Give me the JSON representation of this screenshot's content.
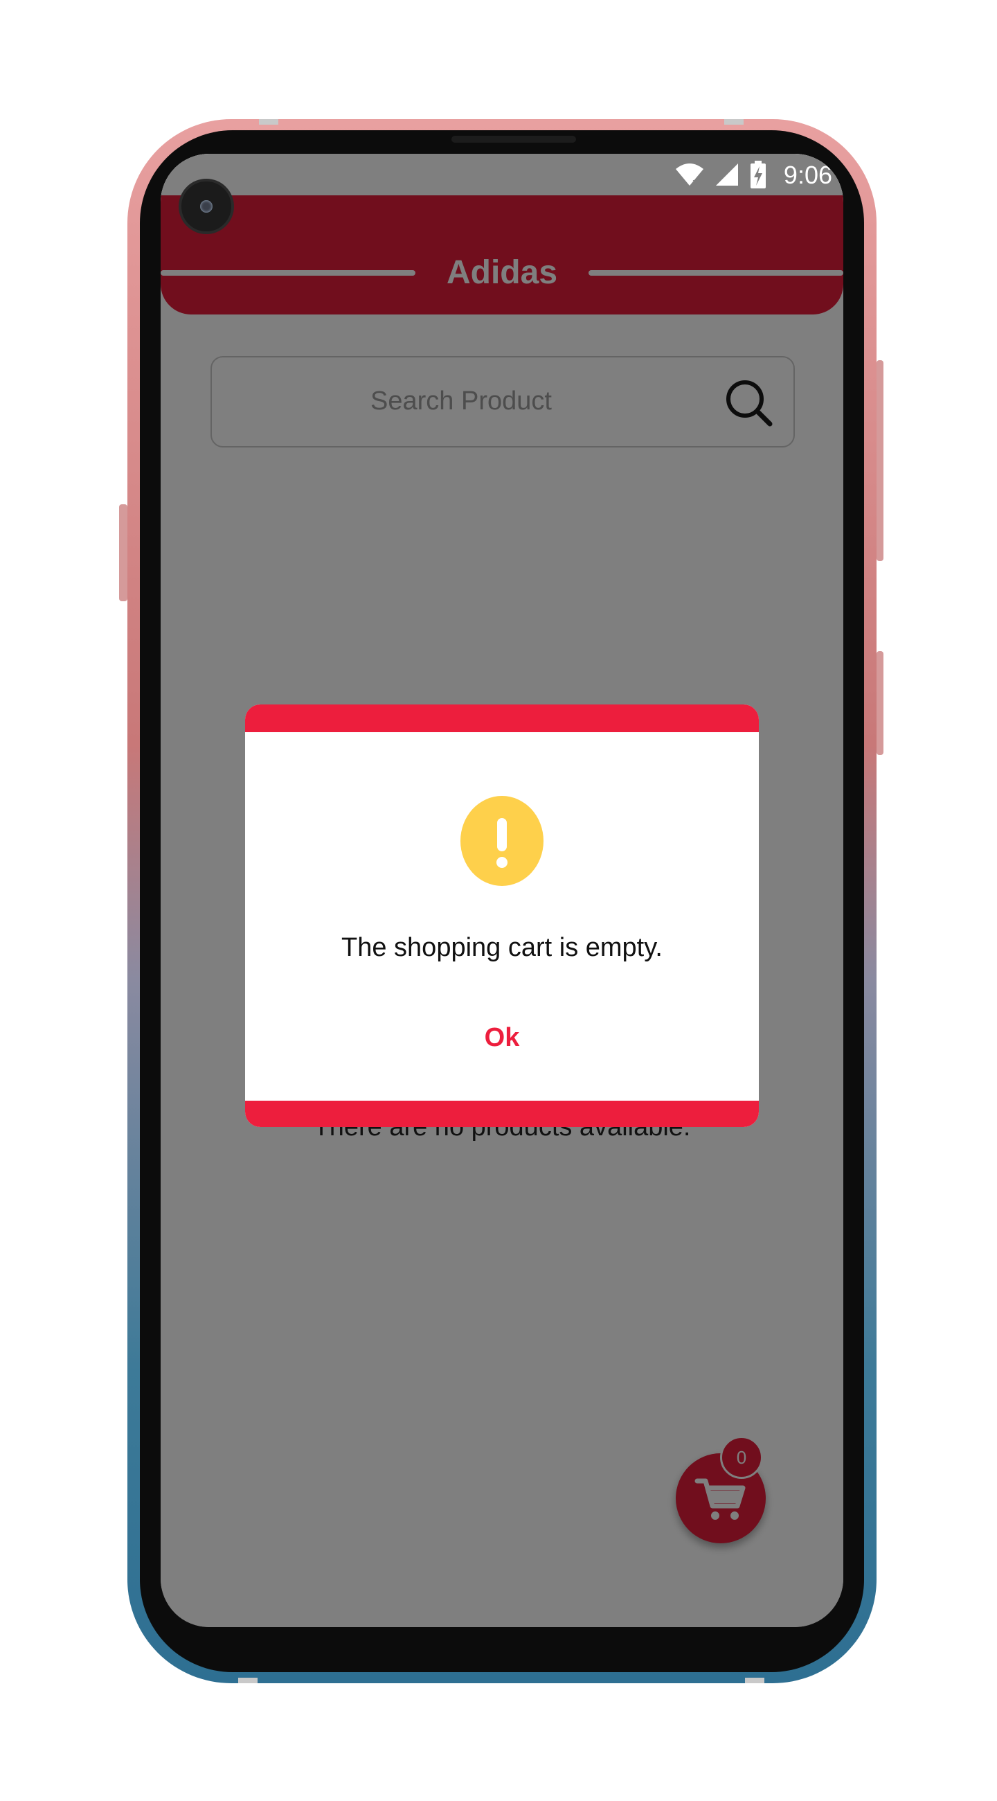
{
  "status_bar": {
    "time": "9:06",
    "icons": [
      "wifi-icon",
      "signal-icon",
      "battery-charging-icon"
    ]
  },
  "header": {
    "title": "Adidas"
  },
  "search": {
    "placeholder": "Search Product",
    "icon": "search-icon"
  },
  "main": {
    "empty_message": "There are no products available."
  },
  "cart": {
    "count": "0",
    "icon": "shopping-cart-icon"
  },
  "dialog": {
    "icon": "warning-icon",
    "message": "The shopping cart is empty.",
    "ok_label": "Ok"
  },
  "colors": {
    "accent": "#e31d3a",
    "dialog_band": "#ed1e3d",
    "warning": "#fed04b",
    "overlay": "rgba(0,0,0,0.5)"
  }
}
